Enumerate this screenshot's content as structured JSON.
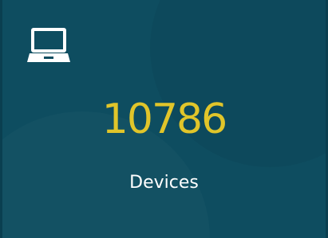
{
  "tile": {
    "icon": "laptop-icon",
    "count": "10786",
    "label": "Devices"
  },
  "colors": {
    "background": "#0e4d60",
    "count": "#e1c52a",
    "label": "#ffffff",
    "icon": "#ffffff"
  }
}
